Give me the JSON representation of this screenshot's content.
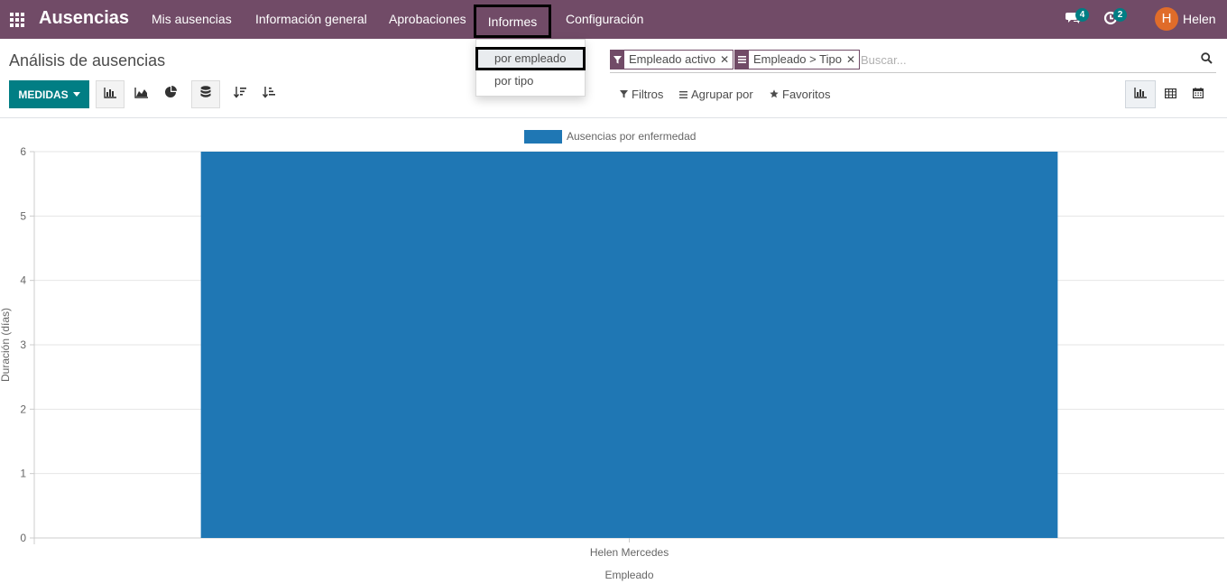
{
  "navbar": {
    "brand": "Ausencias",
    "menu": [
      "Mis ausencias",
      "Información general",
      "Aprobaciones",
      "Informes",
      "Configuración"
    ],
    "messages_count": "4",
    "activities_count": "2",
    "user_initial": "H",
    "user_name": "Helen",
    "color": "#714b67"
  },
  "reports_dropdown": {
    "items": [
      "por empleado",
      "por tipo"
    ]
  },
  "control_panel": {
    "title": "Análisis de ausencias",
    "measures_label": "MEDIDAS",
    "facets": [
      {
        "icon": "filter-icon",
        "label": "Empleado activo"
      },
      {
        "icon": "group-by-icon",
        "label": "Empleado > Tipo"
      }
    ],
    "search_placeholder": "Buscar...",
    "filters_label": "Filtros",
    "group_by_label": "Agrupar por",
    "favorites_label": "Favoritos",
    "accent": "#017e84"
  },
  "chart_data": {
    "type": "bar",
    "categories": [
      "Helen Mercedes"
    ],
    "series": [
      {
        "name": "Ausencias por enfermedad",
        "values": [
          6
        ],
        "color": "#1f77b4"
      }
    ],
    "xlabel": "Empleado",
    "ylabel": "Duración (días)",
    "ylim": [
      0,
      6
    ],
    "yticks": [
      0,
      1,
      2,
      3,
      4,
      5,
      6
    ],
    "grid": true,
    "legend": "top-center"
  }
}
